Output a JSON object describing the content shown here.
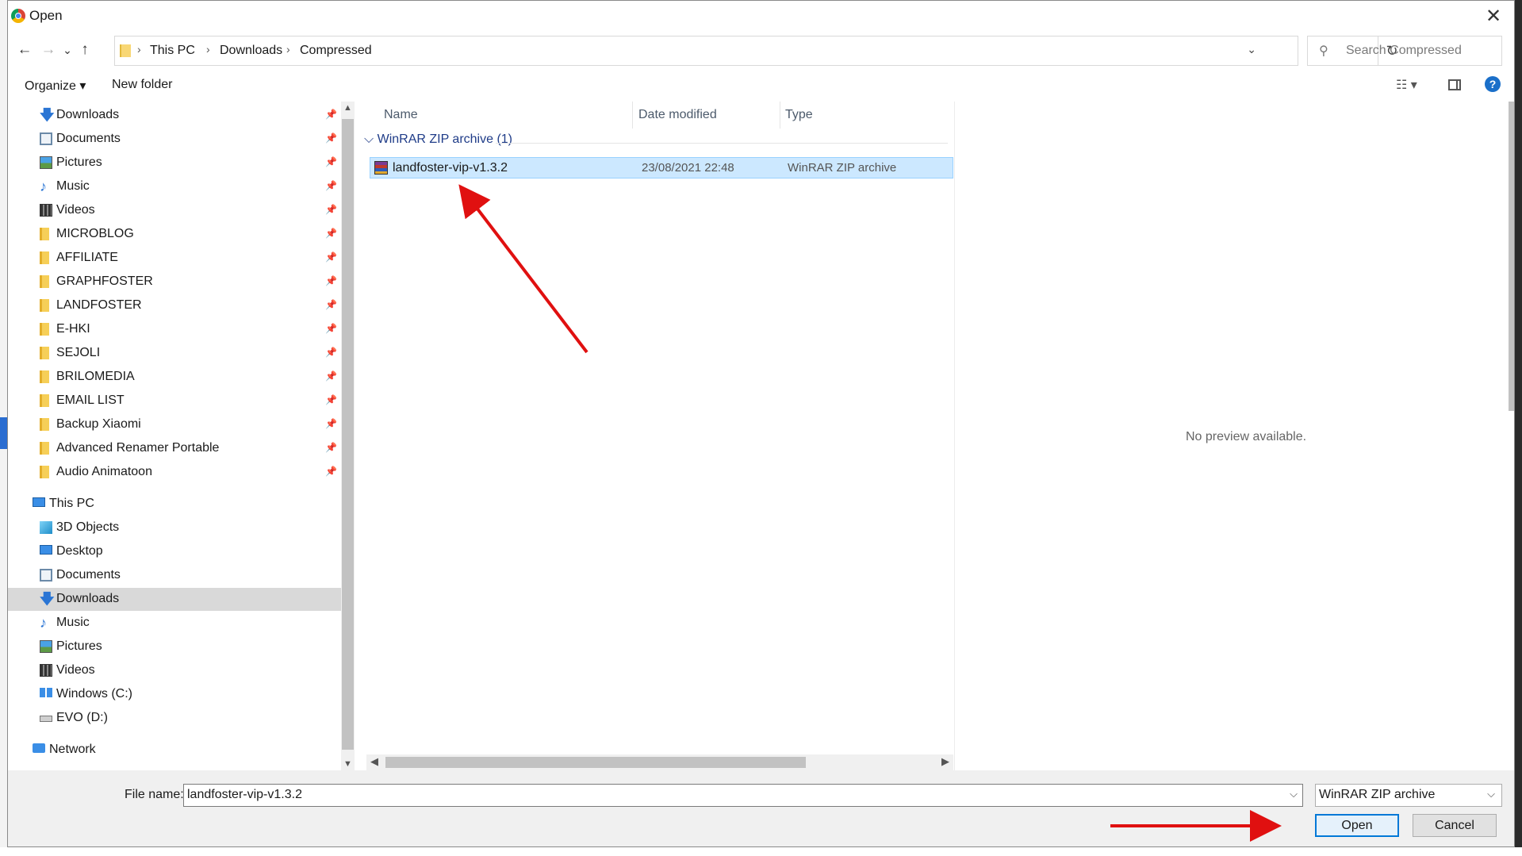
{
  "window": {
    "title": "Open",
    "close_glyph": "✕"
  },
  "nav": {
    "back_glyph": "←",
    "forward_glyph": "→",
    "recent_glyph": "⌄",
    "up_glyph": "↑",
    "breadcrumbs": [
      "This PC",
      "Downloads",
      "Compressed"
    ],
    "crumb_sep": "›",
    "refresh_glyph": "↻",
    "search_placeholder": "Search Compressed"
  },
  "toolbar": {
    "organize": "Organize ▾",
    "new_folder": "New folder",
    "view_glyph": "☷ ▾",
    "help": "?"
  },
  "sidebar": {
    "pin_glyph": "📌",
    "quick_access": [
      {
        "label": "Downloads",
        "icon": "download-arrow-icon"
      },
      {
        "label": "Documents",
        "icon": "documents-icon"
      },
      {
        "label": "Pictures",
        "icon": "pictures-icon"
      },
      {
        "label": "Music",
        "icon": "music-note-icon"
      },
      {
        "label": "Videos",
        "icon": "videos-icon"
      },
      {
        "label": "MICROBLOG",
        "icon": "folder-icon"
      },
      {
        "label": "AFFILIATE",
        "icon": "folder-icon"
      },
      {
        "label": "GRAPHFOSTER",
        "icon": "folder-icon"
      },
      {
        "label": "LANDFOSTER",
        "icon": "folder-icon"
      },
      {
        "label": "E-HKI",
        "icon": "folder-icon"
      },
      {
        "label": "SEJOLI",
        "icon": "folder-icon"
      },
      {
        "label": "BRILOMEDIA",
        "icon": "folder-icon"
      },
      {
        "label": "EMAIL LIST",
        "icon": "folder-icon"
      },
      {
        "label": "Backup Xiaomi",
        "icon": "folder-icon"
      },
      {
        "label": "Advanced Renamer Portable",
        "icon": "folder-icon"
      },
      {
        "label": "Audio Animatoon",
        "icon": "folder-icon"
      }
    ],
    "this_pc": "This PC",
    "this_pc_items": [
      {
        "label": "3D Objects",
        "icon": "3d-objects-icon"
      },
      {
        "label": "Desktop",
        "icon": "desktop-icon"
      },
      {
        "label": "Documents",
        "icon": "documents-icon"
      },
      {
        "label": "Downloads",
        "icon": "download-arrow-icon",
        "selected": true
      },
      {
        "label": "Music",
        "icon": "music-note-icon"
      },
      {
        "label": "Pictures",
        "icon": "pictures-icon"
      },
      {
        "label": "Videos",
        "icon": "videos-icon"
      },
      {
        "label": "Windows (C:)",
        "icon": "windows-drive-icon"
      },
      {
        "label": "EVO (D:)",
        "icon": "drive-icon"
      }
    ],
    "network": "Network"
  },
  "filelist": {
    "columns": [
      "Name",
      "Date modified",
      "Type"
    ],
    "group_label": "WinRAR ZIP archive (1)",
    "group_glyph": "⌵",
    "files": [
      {
        "name": "landfoster-vip-v1.3.2",
        "date": "23/08/2021 22:48",
        "type": "WinRAR ZIP archive",
        "selected": true
      }
    ]
  },
  "preview": {
    "text": "No preview available."
  },
  "bottom": {
    "filename_label": "File name:",
    "filename_value": "landfoster-vip-v1.3.2",
    "filetype_value": "WinRAR ZIP archive",
    "open_label": "Open",
    "cancel_label": "Cancel"
  },
  "colors": {
    "selection": "#cce8ff",
    "accent": "#0078d7",
    "annotation_red": "#e01010"
  }
}
